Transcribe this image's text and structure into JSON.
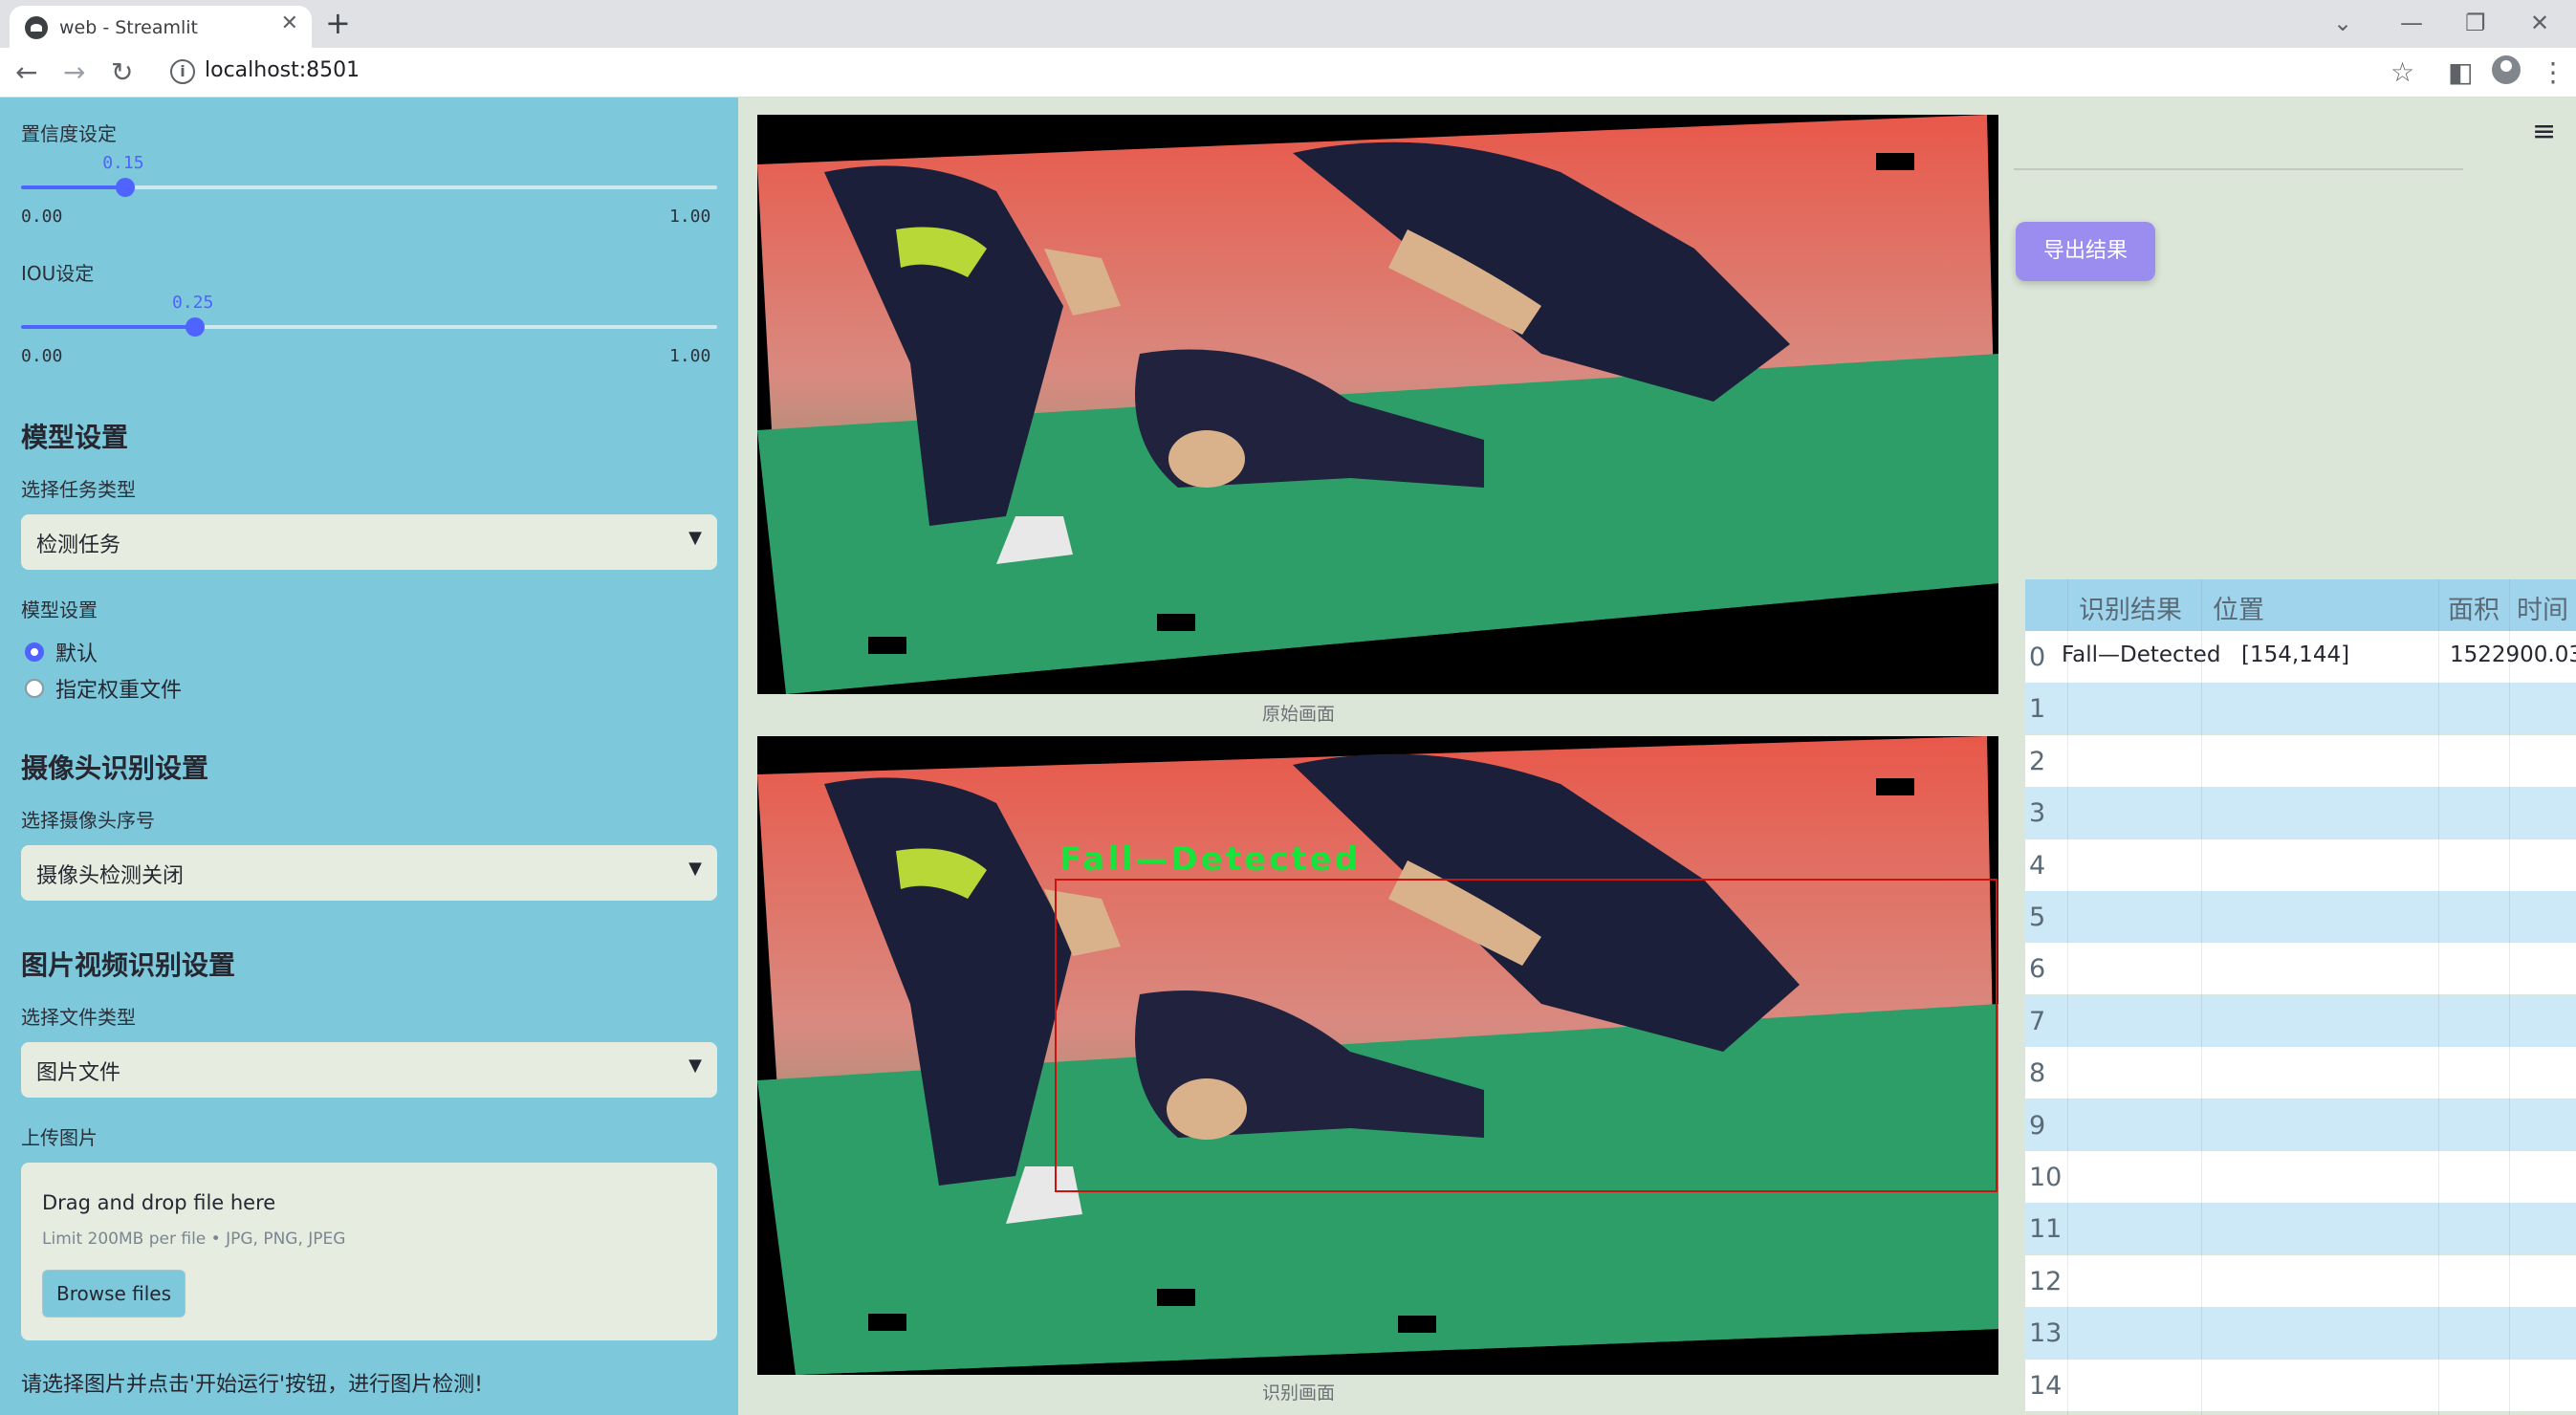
{
  "browser": {
    "tab_title": "web - Streamlit",
    "url": "localhost:8501"
  },
  "sidebar": {
    "confidence": {
      "label": "置信度设定",
      "value": "0.15",
      "min": "0.00",
      "max": "1.00",
      "fraction": 0.15
    },
    "iou": {
      "label": "IOU设定",
      "value": "0.25",
      "min": "0.00",
      "max": "1.00",
      "fraction": 0.25
    },
    "model_section": {
      "heading": "模型设置",
      "task_label": "选择任务类型",
      "task_value": "检测任务",
      "model_label": "模型设置",
      "options": [
        "默认",
        "指定权重文件"
      ],
      "selected": 0
    },
    "camera_section": {
      "heading": "摄像头识别设置",
      "camera_label": "选择摄像头序号",
      "camera_value": "摄像头检测关闭"
    },
    "media_section": {
      "heading": "图片视频识别设置",
      "file_type_label": "选择文件类型",
      "file_type_value": "图片文件",
      "upload_label": "上传图片",
      "drop_text": "Drag and drop file here",
      "limit_text": "Limit 200MB per file • JPG, PNG, JPEG",
      "browse_label": "Browse files"
    },
    "hint": "请选择图片并点击'开始运行'按钮，进行图片检测!"
  },
  "main": {
    "original_caption": "原始画面",
    "result_caption": "识别画面",
    "detection_label": "Fall—Detected"
  },
  "right": {
    "export_label": "导出结果",
    "table": {
      "columns": [
        "识别结果",
        "位置",
        "面积",
        "时间"
      ],
      "rows": [
        {
          "index": "0",
          "result": "Fall—Detected",
          "position": "[154,144]",
          "area": "1522900.03",
          "time": ""
        },
        {
          "index": "1"
        },
        {
          "index": "2"
        },
        {
          "index": "3"
        },
        {
          "index": "4"
        },
        {
          "index": "5"
        },
        {
          "index": "6"
        },
        {
          "index": "7"
        },
        {
          "index": "8"
        },
        {
          "index": "9"
        },
        {
          "index": "10"
        },
        {
          "index": "11"
        },
        {
          "index": "12"
        },
        {
          "index": "13"
        },
        {
          "index": "14"
        }
      ]
    }
  },
  "colors": {
    "sidebar_bg": "#7ec8dc",
    "accent": "#4f63ff",
    "export_button": "#9b8cf0",
    "detection_box": "#cc1111",
    "detection_text": "#19e33a"
  },
  "icons": [
    "back-arrow-icon",
    "forward-arrow-icon",
    "reload-icon",
    "info-icon",
    "bookmark-star-icon",
    "side-panel-icon",
    "profile-icon",
    "kebab-menu-icon",
    "hamburger-menu-icon",
    "chevron-down-icon"
  ]
}
